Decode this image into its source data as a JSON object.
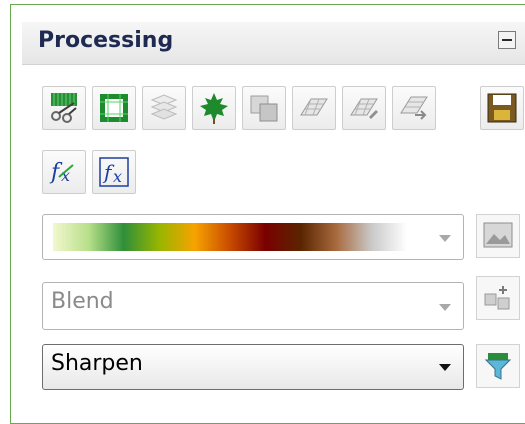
{
  "panel": {
    "title": "Processing"
  },
  "toolbar": {
    "row1": [
      {
        "icon": "cut-tool-icon"
      },
      {
        "icon": "grid-frame-icon"
      },
      {
        "icon": "layers-icon"
      },
      {
        "icon": "maple-leaf-icon"
      },
      {
        "icon": "overlapping-squares-icon"
      },
      {
        "icon": "grid-layer-icon"
      },
      {
        "icon": "grid-layer-edit-icon"
      },
      {
        "icon": "grid-layer-arrow-icon"
      },
      {
        "icon": "save-icon"
      }
    ],
    "row2": [
      {
        "icon": "function-icon"
      },
      {
        "icon": "function-box-icon"
      }
    ]
  },
  "colormap": {
    "colors": [
      "#f2f7cf",
      "#b8e08a",
      "#2f8f3a",
      "#97b500",
      "#f7a300",
      "#c84b00",
      "#7a0000",
      "#5a2500",
      "#a86a3e",
      "#c9c9c9",
      "#ffffff"
    ]
  },
  "blend_select": {
    "value": "Blend"
  },
  "filter_select": {
    "value": "Sharpen"
  },
  "side_buttons": [
    "image-icon",
    "add-tile-icon",
    "filter-funnel-icon"
  ]
}
